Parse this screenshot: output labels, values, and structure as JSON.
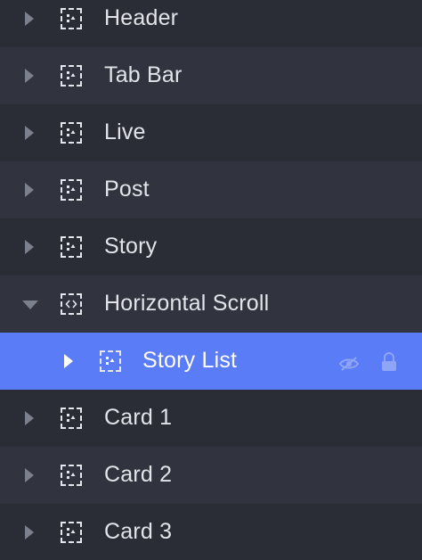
{
  "layers": [
    {
      "label": "Header",
      "expanded": false,
      "icon": "frame-icon"
    },
    {
      "label": "Tab Bar",
      "expanded": false,
      "icon": "frame-icon"
    },
    {
      "label": "Live",
      "expanded": false,
      "icon": "frame-icon"
    },
    {
      "label": "Post",
      "expanded": false,
      "icon": "frame-icon"
    },
    {
      "label": "Story",
      "expanded": false,
      "icon": "frame-icon"
    },
    {
      "label": "Horizontal Scroll",
      "expanded": true,
      "icon": "scroll-frame-icon"
    },
    {
      "label": "Story List",
      "expanded": false,
      "selected": true,
      "icon": "frame-icon",
      "actions": [
        "hidden-eye-icon",
        "lock-icon"
      ]
    },
    {
      "label": "Card 1",
      "expanded": false,
      "icon": "frame-icon"
    },
    {
      "label": "Card 2",
      "expanded": false,
      "icon": "frame-icon"
    },
    {
      "label": "Card 3",
      "expanded": false,
      "icon": "frame-icon"
    }
  ],
  "colors": {
    "selected_background": "#5a7cf6",
    "row_dark": "#2a2c36",
    "row_light": "#31333e",
    "text": "#e3e4ea"
  }
}
